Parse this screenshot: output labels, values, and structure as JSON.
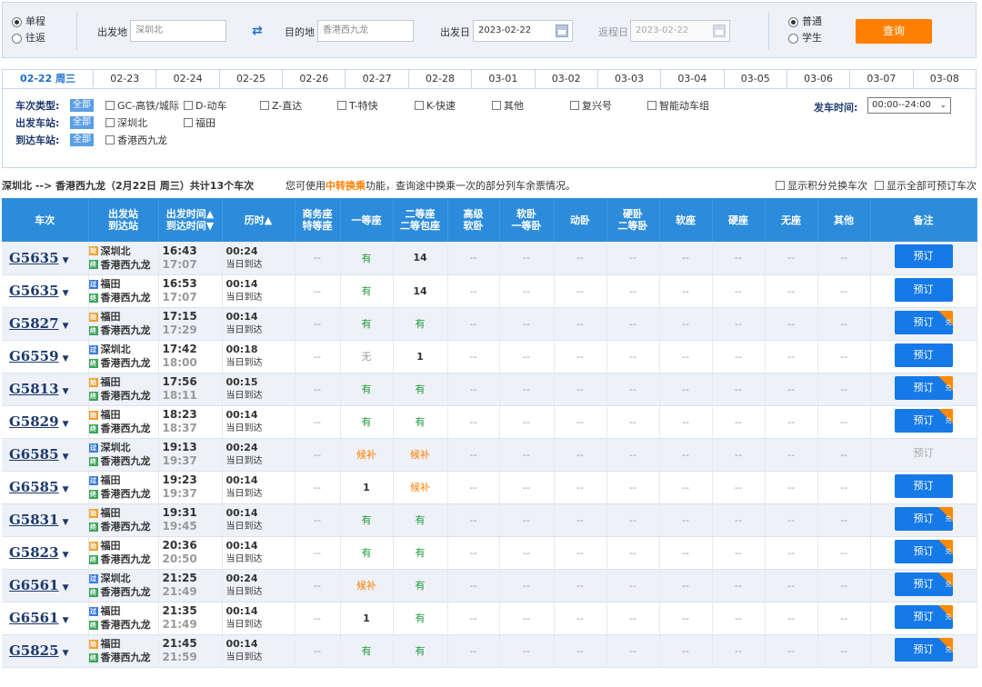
{
  "search": {
    "trip_types": [
      {
        "label": "单程",
        "checked": true
      },
      {
        "label": "往返",
        "checked": false
      }
    ],
    "from_label": "出发地",
    "from_value": "深圳北",
    "to_label": "目的地",
    "to_value": "香港西九龙",
    "depart_label": "出发日",
    "depart_value": "2023-02-22",
    "return_label": "返程日",
    "return_value": "2023-02-22",
    "passenger_types": [
      {
        "label": "普通",
        "checked": true
      },
      {
        "label": "学生",
        "checked": false
      }
    ],
    "query_label": "查询"
  },
  "date_tabs": [
    "02-22 周三",
    "02-23",
    "02-24",
    "02-25",
    "02-26",
    "02-27",
    "02-28",
    "03-01",
    "03-02",
    "03-03",
    "03-04",
    "03-05",
    "03-06",
    "03-07",
    "03-08"
  ],
  "filters": {
    "type_label": "车次类型:",
    "all_label": "全部",
    "types": [
      "GC-高铁/城际",
      "D-动车",
      "Z-直达",
      "T-特快",
      "K-快速",
      "其他",
      "复兴号",
      "智能动车组"
    ],
    "dep_station_label": "出发车站:",
    "dep_stations": [
      "深圳北",
      "福田"
    ],
    "arr_station_label": "到达车站:",
    "arr_stations": [
      "香港西九龙"
    ],
    "dep_time_label": "发车时间:",
    "dep_time_value": "00:00--24:00"
  },
  "summary": {
    "route": "深圳北 --> 香港西九龙（2月22日 周三）共计13个车次",
    "hint_pre": "您可使用",
    "hint_em": "中转换乘",
    "hint_post": "功能，查询途中换乘一次的部分列车余票情况。",
    "opt1": "显示积分兑换车次",
    "opt2": "显示全部可预订车次"
  },
  "columns": [
    "车次",
    "出发站\n到达站",
    "出发时间▲\n到达时间▼",
    "历时▲",
    "商务座\n特等座",
    "一等座",
    "二等座\n二等包座",
    "高级\n软卧",
    "软卧\n一等卧",
    "动卧",
    "硬卧\n二等卧",
    "软座",
    "硬座",
    "无座",
    "其他",
    "备注"
  ],
  "trains": [
    {
      "no": "G5635",
      "from": "深圳北",
      "from_tag": "始",
      "to": "香港西九龙",
      "dep": "16:43",
      "arr": "17:07",
      "dur": "00:24",
      "day": "当日到达",
      "first": "有",
      "second": "14",
      "book": "预订",
      "dui": false,
      "bookable": true
    },
    {
      "no": "G5635",
      "from": "福田",
      "from_tag": "过",
      "to": "香港西九龙",
      "dep": "16:53",
      "arr": "17:07",
      "dur": "00:14",
      "day": "当日到达",
      "first": "有",
      "second": "14",
      "book": "预订",
      "dui": false,
      "bookable": true
    },
    {
      "no": "G5827",
      "from": "福田",
      "from_tag": "始",
      "to": "香港西九龙",
      "dep": "17:15",
      "arr": "17:29",
      "dur": "00:14",
      "day": "当日到达",
      "first": "有",
      "second": "有",
      "book": "预订",
      "dui": true,
      "bookable": true
    },
    {
      "no": "G6559",
      "from": "深圳北",
      "from_tag": "过",
      "to": "香港西九龙",
      "dep": "17:42",
      "arr": "18:00",
      "dur": "00:18",
      "day": "当日到达",
      "first": "无",
      "second": "1",
      "book": "预订",
      "dui": false,
      "bookable": true
    },
    {
      "no": "G5813",
      "from": "福田",
      "from_tag": "始",
      "to": "香港西九龙",
      "dep": "17:56",
      "arr": "18:11",
      "dur": "00:15",
      "day": "当日到达",
      "first": "有",
      "second": "有",
      "book": "预订",
      "dui": true,
      "bookable": true
    },
    {
      "no": "G5829",
      "from": "福田",
      "from_tag": "始",
      "to": "香港西九龙",
      "dep": "18:23",
      "arr": "18:37",
      "dur": "00:14",
      "day": "当日到达",
      "first": "有",
      "second": "有",
      "book": "预订",
      "dui": true,
      "bookable": true
    },
    {
      "no": "G6585",
      "from": "深圳北",
      "from_tag": "过",
      "to": "香港西九龙",
      "dep": "19:13",
      "arr": "19:37",
      "dur": "00:24",
      "day": "当日到达",
      "first": "候补",
      "second": "候补",
      "book": "预订",
      "dui": false,
      "bookable": false
    },
    {
      "no": "G6585",
      "from": "福田",
      "from_tag": "过",
      "to": "香港西九龙",
      "dep": "19:23",
      "arr": "19:37",
      "dur": "00:14",
      "day": "当日到达",
      "first": "1",
      "second": "候补",
      "book": "预订",
      "dui": false,
      "bookable": true
    },
    {
      "no": "G5831",
      "from": "福田",
      "from_tag": "始",
      "to": "香港西九龙",
      "dep": "19:31",
      "arr": "19:45",
      "dur": "00:14",
      "day": "当日到达",
      "first": "有",
      "second": "有",
      "book": "预订",
      "dui": true,
      "bookable": true
    },
    {
      "no": "G5823",
      "from": "福田",
      "from_tag": "始",
      "to": "香港西九龙",
      "dep": "20:36",
      "arr": "20:50",
      "dur": "00:14",
      "day": "当日到达",
      "first": "有",
      "second": "有",
      "book": "预订",
      "dui": true,
      "bookable": true
    },
    {
      "no": "G6561",
      "from": "深圳北",
      "from_tag": "过",
      "to": "香港西九龙",
      "dep": "21:25",
      "arr": "21:49",
      "dur": "00:24",
      "day": "当日到达",
      "first": "候补",
      "second": "有",
      "book": "预订",
      "dui": true,
      "bookable": true
    },
    {
      "no": "G6561",
      "from": "福田",
      "from_tag": "过",
      "to": "香港西九龙",
      "dep": "21:35",
      "arr": "21:49",
      "dur": "00:14",
      "day": "当日到达",
      "first": "1",
      "second": "有",
      "book": "预订",
      "dui": true,
      "bookable": true
    },
    {
      "no": "G5825",
      "from": "福田",
      "from_tag": "始",
      "to": "香港西九龙",
      "dep": "21:45",
      "arr": "21:59",
      "dur": "00:14",
      "day": "当日到达",
      "first": "有",
      "second": "有",
      "book": "预订",
      "dui": true,
      "bookable": true
    }
  ],
  "dash": "--",
  "end_tag": "终",
  "dui_label": "兑",
  "colors": {
    "header": "#2c8cdb",
    "accent": "#1679e8",
    "orange": "#ff7f00",
    "green": "#1c9a3a"
  }
}
